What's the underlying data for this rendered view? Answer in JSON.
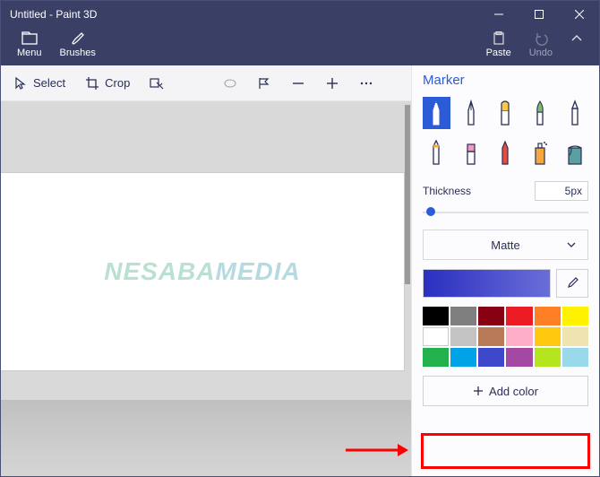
{
  "window": {
    "title": "Untitled - Paint 3D"
  },
  "menubar": {
    "menu": "Menu",
    "brushes": "Brushes",
    "paste": "Paste",
    "undo": "Undo"
  },
  "toolbar": {
    "select": "Select",
    "crop": "Crop"
  },
  "panel": {
    "heading": "Marker",
    "thicknessLabel": "Thickness",
    "thicknessValue": "5px",
    "materialLabel": "Matte",
    "addColor": "Add color",
    "brushes": [
      "marker",
      "calligraphy-pen",
      "oil-brush",
      "watercolor",
      "pixel-pen",
      "pencil",
      "eraser",
      "crayon",
      "spray-can",
      "fill"
    ],
    "palette": [
      "#000000",
      "#7f7f7f",
      "#870014",
      "#ed1c24",
      "#ff7f27",
      "#fff200",
      "#ffffff",
      "#c3c3c3",
      "#b97a57",
      "#ffaec9",
      "#ffc90e",
      "#efe4b0",
      "#22b14c",
      "#00a2e8",
      "#3f48cc",
      "#a349a4",
      "#b5e61d",
      "#99d9ea"
    ]
  },
  "watermark": {
    "a": "NESABA",
    "b": "MEDIA"
  }
}
